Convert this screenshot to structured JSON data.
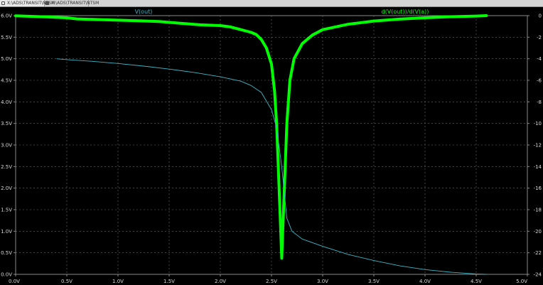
{
  "tabs": [
    {
      "label": "X:\\ADS\\TRANSIT\\NTSM",
      "active": true
    },
    {
      "label": "X:\\ADS\\TRANSIT\\NTSM",
      "active": false
    }
  ],
  "colors": {
    "background": "#000000",
    "grid": "#6e6e6e",
    "axis_text": "#d8d8d8",
    "vout": "#3fb6c6",
    "deriv": "#00ff00"
  },
  "chart_data": {
    "type": "line",
    "x_ticks": [
      "0.0V",
      "0.5V",
      "1.0V",
      "1.5V",
      "2.0V",
      "2.5V",
      "3.0V",
      "3.5V",
      "4.0V",
      "4.5V",
      "5.0V"
    ],
    "xlim": [
      0,
      5
    ],
    "y_left_ticks": [
      "0.0V",
      "0.5V",
      "1.0V",
      "1.5V",
      "2.0V",
      "2.5V",
      "3.0V",
      "3.5V",
      "4.0V",
      "4.5V",
      "5.0V",
      "5.5V",
      "6.0V"
    ],
    "ylim_left": [
      0,
      6
    ],
    "y_right_ticks": [
      "-24",
      "-22",
      "-20",
      "-18",
      "-16",
      "-14",
      "-12",
      "-10",
      "-8",
      "-6",
      "-4",
      "-2",
      "0"
    ],
    "ylim_right": [
      -24,
      0
    ],
    "grid": "dashed",
    "series": [
      {
        "name": "V(out)",
        "axis": "left",
        "color": "#3fb6c6",
        "points": [
          [
            0.4,
            5.0
          ],
          [
            0.5,
            4.98
          ],
          [
            0.75,
            4.94
          ],
          [
            1.0,
            4.89
          ],
          [
            1.25,
            4.83
          ],
          [
            1.5,
            4.76
          ],
          [
            1.75,
            4.68
          ],
          [
            2.0,
            4.58
          ],
          [
            2.2,
            4.48
          ],
          [
            2.3,
            4.38
          ],
          [
            2.4,
            4.22
          ],
          [
            2.5,
            3.82
          ],
          [
            2.55,
            3.4
          ],
          [
            2.6,
            2.5
          ],
          [
            2.65,
            1.3
          ],
          [
            2.7,
            1.0
          ],
          [
            2.8,
            0.82
          ],
          [
            3.0,
            0.65
          ],
          [
            3.25,
            0.46
          ],
          [
            3.5,
            0.32
          ],
          [
            3.75,
            0.2
          ],
          [
            4.0,
            0.11
          ],
          [
            4.25,
            0.05
          ],
          [
            4.5,
            0.01
          ],
          [
            4.6,
            0.0
          ]
        ]
      },
      {
        "name": "d(V(out))/d(V(a))",
        "axis": "right",
        "color": "#00ff00",
        "points": [
          [
            0.0,
            -0.02
          ],
          [
            0.1,
            -0.05
          ],
          [
            0.2,
            -0.08
          ],
          [
            0.3,
            -0.12
          ],
          [
            0.4,
            -0.16
          ],
          [
            0.5,
            -0.2
          ],
          [
            0.6,
            -0.3
          ],
          [
            0.8,
            -0.36
          ],
          [
            1.0,
            -0.42
          ],
          [
            1.2,
            -0.48
          ],
          [
            1.4,
            -0.55
          ],
          [
            1.6,
            -0.7
          ],
          [
            1.8,
            -0.85
          ],
          [
            2.0,
            -0.92
          ],
          [
            2.1,
            -1.05
          ],
          [
            2.2,
            -1.3
          ],
          [
            2.3,
            -1.55
          ],
          [
            2.35,
            -1.75
          ],
          [
            2.4,
            -2.2
          ],
          [
            2.45,
            -3.0
          ],
          [
            2.5,
            -4.5
          ],
          [
            2.53,
            -7.0
          ],
          [
            2.55,
            -10.0
          ],
          [
            2.57,
            -15.0
          ],
          [
            2.59,
            -20.0
          ],
          [
            2.6,
            -22.5
          ],
          [
            2.61,
            -20.0
          ],
          [
            2.63,
            -15.0
          ],
          [
            2.65,
            -10.0
          ],
          [
            2.68,
            -6.0
          ],
          [
            2.72,
            -4.0
          ],
          [
            2.8,
            -2.6
          ],
          [
            2.9,
            -1.8
          ],
          [
            3.0,
            -1.3
          ],
          [
            3.25,
            -0.8
          ],
          [
            3.5,
            -0.5
          ],
          [
            3.75,
            -0.32
          ],
          [
            4.0,
            -0.2
          ],
          [
            4.25,
            -0.1
          ],
          [
            4.5,
            -0.04
          ],
          [
            4.6,
            0.0
          ]
        ]
      }
    ]
  }
}
